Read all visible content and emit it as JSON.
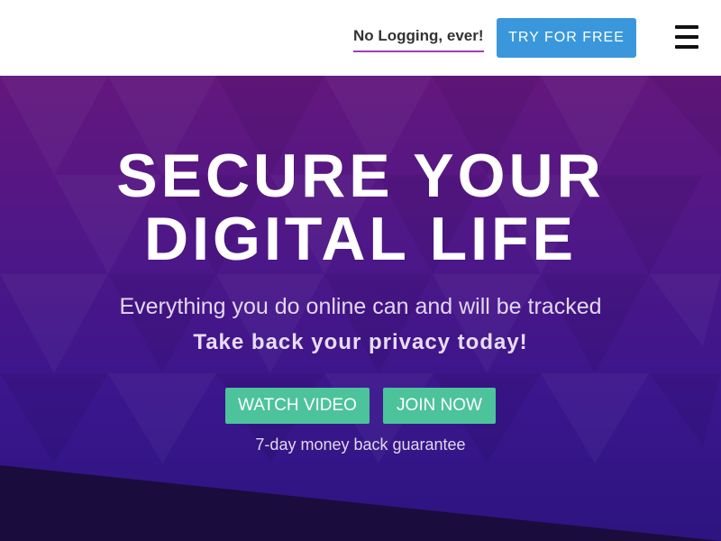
{
  "header": {
    "nav_link": "No Logging, ever!",
    "cta_label": "TRY FOR FREE",
    "menu_icon": "hamburger-menu-icon"
  },
  "hero": {
    "headline_line1": "SECURE YOUR",
    "headline_line2": "DIGITAL LIFE",
    "subtitle": "Everything you do online can and will be tracked",
    "subtitle_bold": "Take back your privacy today!",
    "watch_video_label": "WATCH VIDEO",
    "join_now_label": "JOIN NOW",
    "guarantee": "7-day money back guarantee"
  },
  "colors": {
    "cta_blue": "#3a97db",
    "button_green": "#4cc39a",
    "hero_purple_top": "#64177d",
    "hero_purple_bottom": "#2d1480",
    "accent_underline": "#9b3fc0"
  }
}
